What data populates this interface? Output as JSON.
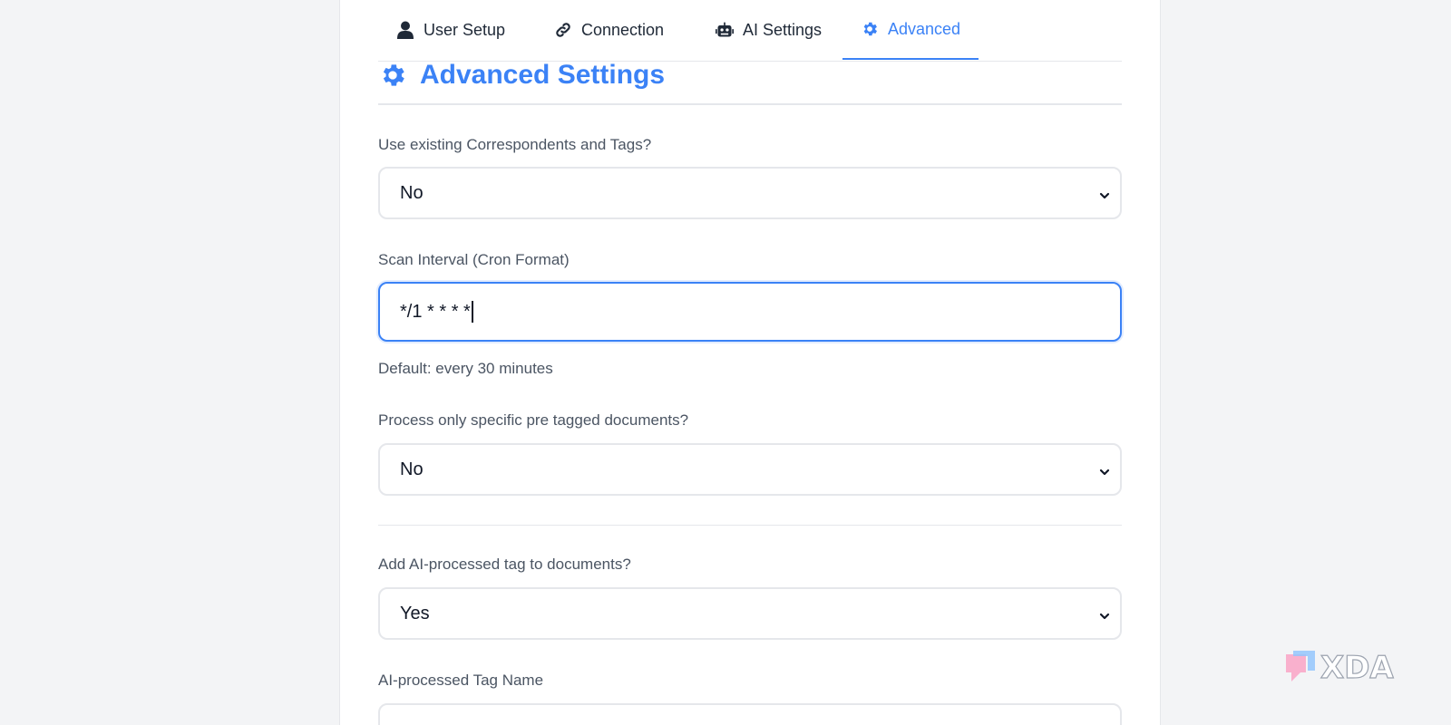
{
  "tabs": [
    {
      "label": "User Setup",
      "icon": "user-icon"
    },
    {
      "label": "Connection",
      "icon": "link-icon"
    },
    {
      "label": "AI Settings",
      "icon": "robot-icon"
    },
    {
      "label": "Advanced",
      "icon": "gear-icon",
      "active": true
    }
  ],
  "section": {
    "title": "Advanced Settings",
    "icon": "gear-icon"
  },
  "fields": {
    "use_existing": {
      "label": "Use existing Correspondents and Tags?",
      "value": "No"
    },
    "scan_interval": {
      "label": "Scan Interval (Cron Format)",
      "value": "*/1 * * * *",
      "hint": "Default: every 30 minutes"
    },
    "pre_tagged": {
      "label": "Process only specific pre tagged documents?",
      "value": "No"
    },
    "add_tag": {
      "label": "Add AI-processed tag to documents?",
      "value": "Yes"
    },
    "tag_name": {
      "label": "AI-processed Tag Name"
    }
  },
  "colors": {
    "accent": "#3b82f6",
    "border": "#e5e7eb",
    "background": "#f3f4f6"
  }
}
